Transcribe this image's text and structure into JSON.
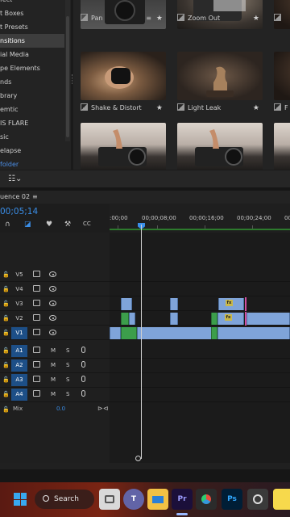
{
  "effects_list": {
    "items": [
      {
        "label": "t Boxes",
        "selected": false
      },
      {
        "label": "t Presets",
        "selected": false
      },
      {
        "label": "nsitions",
        "selected": true
      },
      {
        "label": "ial Media",
        "selected": false
      },
      {
        "label": "pe Elements",
        "selected": false
      },
      {
        "label": "nds",
        "selected": false
      },
      {
        "label": "brary",
        "selected": false
      },
      {
        "label": "emtic",
        "selected": false
      },
      {
        "label": "IS FLARE",
        "selected": false
      },
      {
        "label": "sic",
        "selected": false
      },
      {
        "label": "elapse",
        "selected": false
      },
      {
        "label": "folder",
        "selected": false
      }
    ]
  },
  "tiles": [
    {
      "caption": "Pan",
      "has_menu": true
    },
    {
      "caption": "Zoom Out",
      "has_menu": false
    },
    {
      "caption": "Shake & Distort",
      "has_menu": false
    },
    {
      "caption": "Light Leak",
      "has_menu": false
    },
    {
      "caption": "F",
      "has_menu": false
    }
  ],
  "icons": {
    "view_toggle": "list-view-icon",
    "star": "★",
    "menu": "≡"
  },
  "timeline": {
    "sequence_name": "uence 02",
    "menu_glyph": "≡",
    "timecode": "00;05;14",
    "ruler_labels": [
      ":00;00",
      "00;00;08;00",
      "00;00;16;00",
      "00;00;24;00",
      "00"
    ],
    "video_tracks": [
      "V5",
      "V4",
      "V3",
      "V2",
      "V1"
    ],
    "audio_tracks": [
      "A1",
      "A2",
      "A3",
      "A4"
    ],
    "mute_label": "M",
    "solo_label": "S",
    "mix_label": "Mix",
    "mix_value": "0.0",
    "fx_label": "fx"
  },
  "taskbar": {
    "search_label": "Search",
    "apps": [
      "file-explorer",
      "task-view",
      "teams",
      "files",
      "premiere-pro",
      "davinci-resolve",
      "photoshop",
      "obs",
      "sticky-notes"
    ],
    "premiere_label": "Pr",
    "photoshop_label": "Ps"
  },
  "colors": {
    "accent_blue": "#3a8ee8",
    "clip_blue": "#7fa4d9",
    "clip_green": "#3c9e4b",
    "track_target": "#1d4f87",
    "fx_yellow": "#c9b84a",
    "marker_pink": "#d34fa0"
  }
}
